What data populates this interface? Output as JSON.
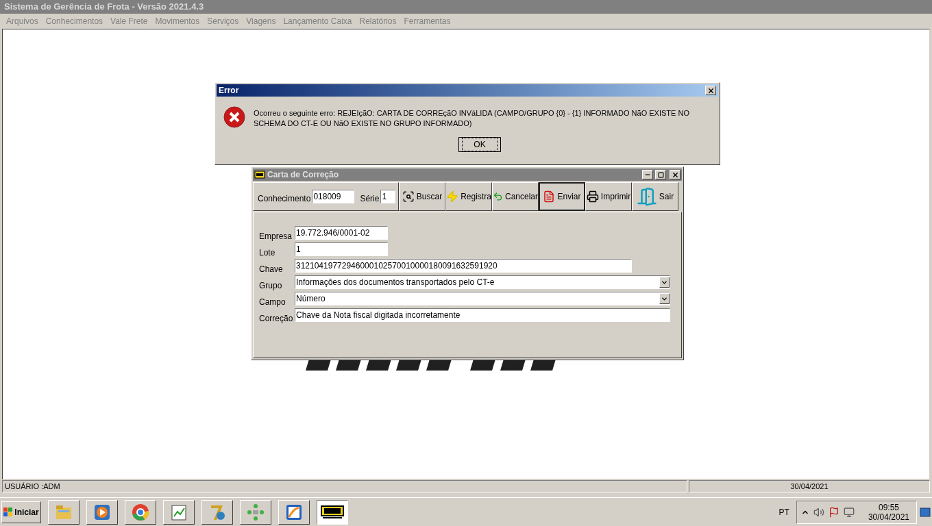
{
  "app": {
    "title": "Sistema de Gerência de Frota - Versão 2021.4.3",
    "menu": [
      "Arquivos",
      "Conhecimentos",
      "Vale Frete",
      "Movimentos",
      "Serviços",
      "Viagens",
      "Lançamento Caixa",
      "Relatórios",
      "Ferramentas"
    ]
  },
  "error_dialog": {
    "title": "Error",
    "message": "Ocorreu o seguinte erro: REJEIçãO: CARTA DE CORREçãO INVáLIDA (CAMPO/GRUPO {0} - {1} INFORMADO NãO EXISTE NO SCHEMA DO CT-E OU NãO EXISTE NO GRUPO INFORMADO)",
    "button": "OK"
  },
  "carta_window": {
    "title": "Carta de Correção",
    "conhecimento_label": "Conhecimento",
    "conhecimento": "018009",
    "serie_label": "Série",
    "serie": "1",
    "toolbar": [
      {
        "kind": "search",
        "label": "Buscar",
        "focused": false
      },
      {
        "kind": "register",
        "label": "Registra",
        "focused": false
      },
      {
        "kind": "cancel",
        "label": "Cancelar",
        "focused": false
      },
      {
        "kind": "send",
        "label": "Enviar",
        "focused": true
      },
      {
        "kind": "print",
        "label": "Imprimir",
        "focused": false
      },
      {
        "kind": "exit",
        "label": "Sair",
        "focused": false
      }
    ],
    "fields": [
      {
        "kind": "short",
        "label": "Empresa",
        "value": "19.772.946/0001-02"
      },
      {
        "kind": "short",
        "label": "Lote",
        "value": "1"
      },
      {
        "kind": "long",
        "label": "Chave",
        "value": "31210419772946000102570010000180091632591920"
      },
      {
        "kind": "select",
        "label": "Grupo",
        "value": "Informações dos documentos transportados pelo CT-e"
      },
      {
        "kind": "select",
        "label": "Campo",
        "value": "Número"
      },
      {
        "kind": "wide",
        "label": "Correção",
        "value": "Chave da Nota fiscal digitada incorretamente"
      }
    ]
  },
  "status_bar": {
    "user": "USUÁRIO :ADM",
    "date": "30/04/2021"
  },
  "taskbar": {
    "start": "Iniciar",
    "apps": [
      {
        "kind": "explorer",
        "selected": false
      },
      {
        "kind": "media",
        "selected": false
      },
      {
        "kind": "chrome",
        "selected": false
      },
      {
        "kind": "notepad",
        "selected": false
      },
      {
        "kind": "seven",
        "selected": false
      },
      {
        "kind": "dots",
        "selected": false
      },
      {
        "kind": "chart",
        "selected": false
      },
      {
        "kind": "tup",
        "selected": true
      }
    ],
    "language": "PT",
    "time": "09:55",
    "date": "30/04/2021"
  }
}
